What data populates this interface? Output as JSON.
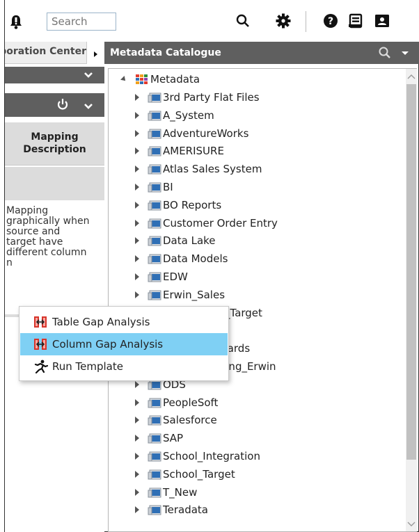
{
  "toolbar": {
    "search_placeholder": "Search",
    "icons": [
      "notification-bell-icon",
      "search-icon",
      "gear-icon",
      "help-icon",
      "document-list-icon",
      "user-card-icon"
    ]
  },
  "left_pane": {
    "tab_label": "Collaboration Center",
    "column_header": "Mapping Description",
    "description": "Mapping graphically when source and target have different column n"
  },
  "right_pane": {
    "title": "Metadata Catalogue",
    "root": "Metadata",
    "items": [
      "3rd Party Flat Files",
      "A_System",
      "AdventureWorks",
      "AMERISURE",
      "Atlas Sales System",
      "BI",
      "BO Reports",
      "Customer Order Entry",
      "Data Lake",
      "Data Models",
      "EDW",
      "Erwin_Sales",
      "Erwin_Sales_Target",
      "",
      "Erwin_Standards",
      "Erwin_Mapping_Erwin",
      "ODS",
      "PeopleSoft",
      "Salesforce",
      "SAP",
      "School_Integration",
      "School_Target",
      "T_New",
      "Teradata"
    ]
  },
  "context_menu": {
    "items": [
      {
        "label": "Table Gap Analysis",
        "icon": "gap-analysis-icon"
      },
      {
        "label": "Column Gap Analysis",
        "icon": "gap-analysis-icon"
      },
      {
        "label": "Run Template",
        "icon": "run-icon"
      }
    ]
  },
  "colors": {
    "header_grey": "#5f5f5f",
    "menu_highlight": "#7fd0f4",
    "icon_blue": "#2f6fb5"
  }
}
